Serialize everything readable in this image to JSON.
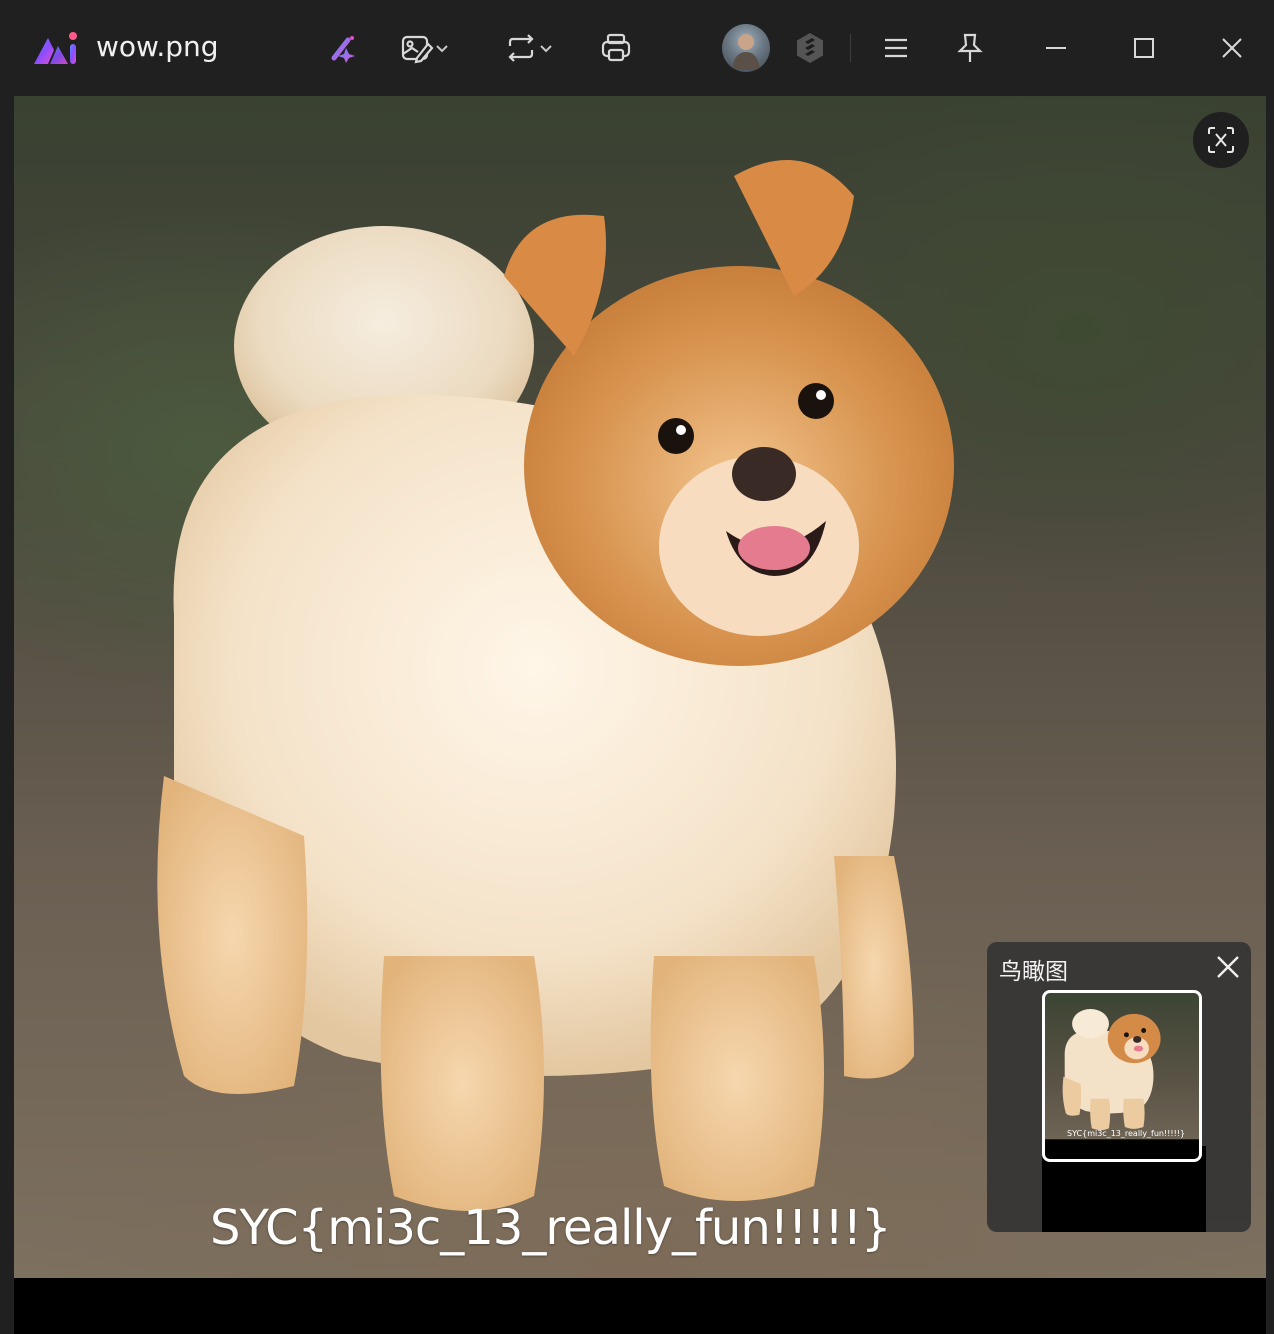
{
  "window": {
    "title": "wow.png",
    "app_icon": "photos-ai-logo-icon"
  },
  "toolbar": {
    "items": [
      {
        "name": "ai-sparkle-icon"
      },
      {
        "name": "edit-image-icon",
        "has_dropdown": true
      },
      {
        "name": "rotate-icon",
        "has_dropdown": true
      },
      {
        "name": "print-icon"
      },
      {
        "name": "user-avatar"
      },
      {
        "name": "extension-icon"
      },
      {
        "name": "menu-icon"
      },
      {
        "name": "pin-icon"
      }
    ],
    "window_controls": [
      "minimize-icon",
      "maximize-icon",
      "close-icon"
    ]
  },
  "image": {
    "caption_text": "SYC{mi3c_13_really_fun!!!!!}",
    "ocr_button": "text-recognize-icon"
  },
  "overview": {
    "title": "鸟瞰图",
    "thumb_caption": "SYC{mi3c_13_really_fun!!!!!}"
  },
  "colors": {
    "titlebar": "#202020",
    "accent_purple": "#7b3cf5",
    "accent_pink": "#e05ad6"
  }
}
